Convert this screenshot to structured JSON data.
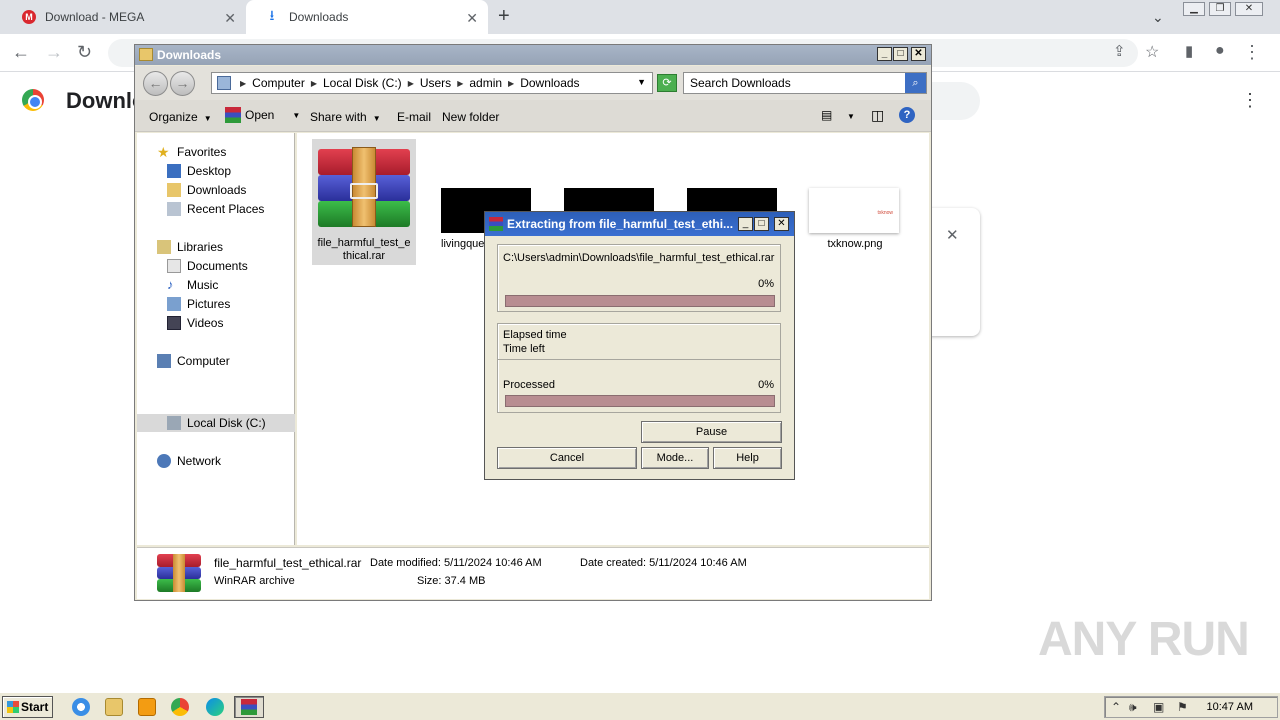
{
  "chrome": {
    "tabs": [
      {
        "label": "Download - MEGA"
      },
      {
        "label": "Downloads"
      }
    ],
    "page_title": "Downloads"
  },
  "explorer": {
    "title": "Downloads",
    "breadcrumb": [
      "Computer",
      "Local Disk (C:)",
      "Users",
      "admin",
      "Downloads"
    ],
    "search_placeholder": "Search Downloads",
    "commands": {
      "organize": "Organize",
      "open": "Open",
      "share": "Share with",
      "email": "E-mail",
      "new_folder": "New folder"
    },
    "nav": {
      "favorites": "Favorites",
      "desktop": "Desktop",
      "downloads": "Downloads",
      "recent": "Recent Places",
      "libraries": "Libraries",
      "documents": "Documents",
      "music": "Music",
      "pictures": "Pictures",
      "videos": "Videos",
      "computer": "Computer",
      "local_disk": "Local Disk (C:)",
      "network": "Network"
    },
    "files": {
      "rar_line1": "file_harmful_test_e",
      "rar_line2": "thical.rar",
      "living": "livingque",
      "png": "txknow.png",
      "png_thumb_text": "txknow"
    },
    "details": {
      "name": "file_harmful_test_ethical.rar",
      "type": "WinRAR archive",
      "modified": "Date modified: 5/11/2024 10:46 AM",
      "created": "Date created: 5/11/2024 10:46 AM",
      "size": "Size: 37.4 MB"
    }
  },
  "extract_dialog": {
    "title": "Extracting from file_harmful_test_ethi...",
    "path": "C:\\Users\\admin\\Downloads\\file_harmful_test_ethical.rar",
    "file_percent": "0%",
    "elapsed_label": "Elapsed time",
    "timeleft_label": "Time left",
    "processed_label": "Processed",
    "processed_percent": "0%",
    "pause": "Pause",
    "cancel": "Cancel",
    "mode": "Mode...",
    "help": "Help"
  },
  "watermark": "ANY RUN",
  "taskbar": {
    "start": "Start",
    "clock": "10:47 AM"
  }
}
